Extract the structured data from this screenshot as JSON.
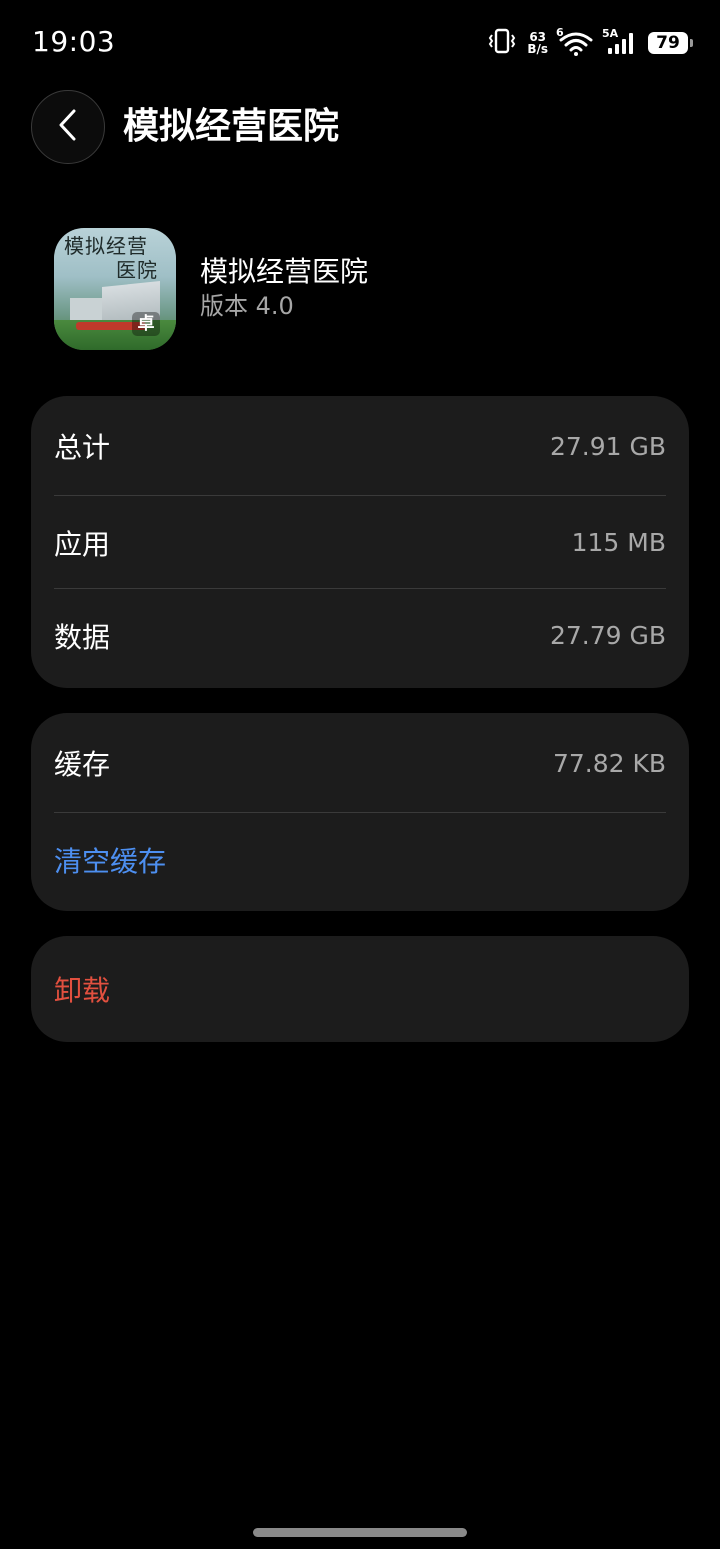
{
  "status_bar": {
    "time": "19:03",
    "net_speed_value": "63",
    "net_speed_unit": "B/s",
    "wifi_tag": "6",
    "cell_tag": "5A",
    "battery_level": "79",
    "icons": [
      "vibrate-icon",
      "wifi-icon",
      "cellular-signal-icon",
      "battery-icon"
    ]
  },
  "header": {
    "back_icon": "chevron-left-icon",
    "title": "模拟经营医院"
  },
  "app_info": {
    "icon_text_line1": "模拟经营",
    "icon_text_line2": "医院",
    "icon_badge": "卓",
    "name": "模拟经营医院",
    "version": "版本 4.0"
  },
  "storage": {
    "rows": [
      {
        "label": "总计",
        "value": "27.91 GB"
      },
      {
        "label": "应用",
        "value": "115 MB"
      },
      {
        "label": "数据",
        "value": "27.79 GB"
      }
    ]
  },
  "cache": {
    "label": "缓存",
    "value": "77.82 KB",
    "clear_label": "清空缓存"
  },
  "uninstall": {
    "label": "卸载"
  },
  "colors": {
    "background": "#000000",
    "card": "#1c1c1c",
    "accent_blue": "#4d8ff0",
    "danger_red": "#e2503f",
    "secondary_text": "#a8a8a8"
  }
}
